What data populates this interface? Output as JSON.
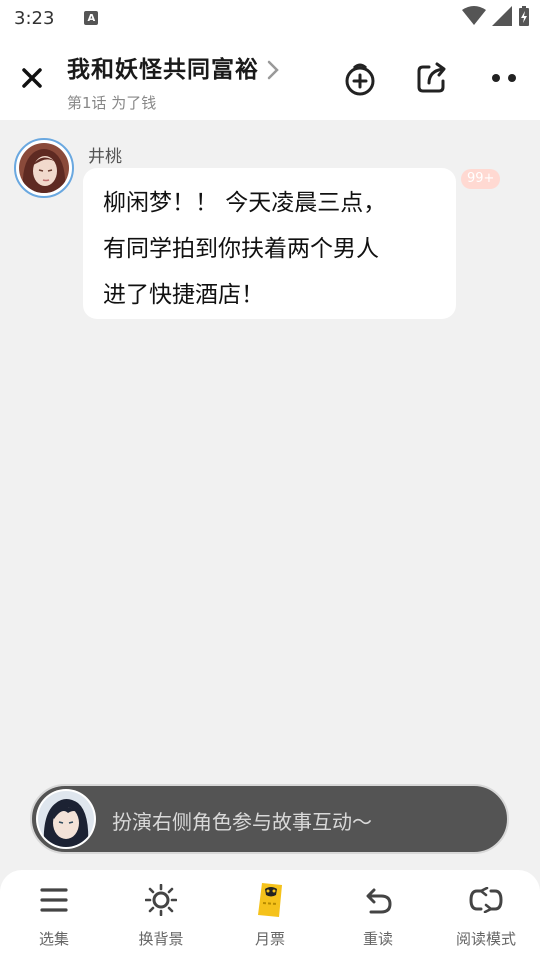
{
  "status": {
    "time": "3:23",
    "a_icon": "A"
  },
  "header": {
    "title": "我和妖怪共同富裕",
    "subtitle": "第1话 为了钱"
  },
  "message": {
    "sender": "井桃",
    "lines": [
      "柳闲梦！！ 今天凌晨三点，",
      "有同学拍到你扶着两个男人",
      "进了快捷酒店！"
    ],
    "badge": "99+"
  },
  "roleplay": {
    "placeholder": "扮演右侧角色参与故事互动～"
  },
  "nav": {
    "items": [
      {
        "label": "选集",
        "icon": "menu-icon"
      },
      {
        "label": "换背景",
        "icon": "sun-icon"
      },
      {
        "label": "月票",
        "icon": "ticket-icon"
      },
      {
        "label": "重读",
        "icon": "undo-icon"
      },
      {
        "label": "阅读模式",
        "icon": "loop-icon"
      }
    ]
  },
  "colors": {
    "accent": "#6aa8e0",
    "badge": "#ffd9d2",
    "bar": "#545454",
    "ticket": "#f5c21b"
  }
}
